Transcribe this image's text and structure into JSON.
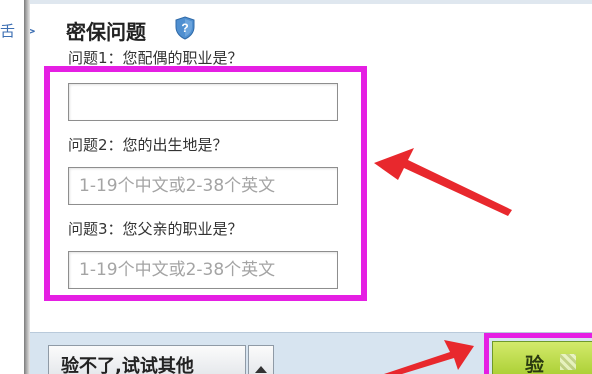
{
  "left_pane": {
    "text": "舌 >"
  },
  "security_questions": {
    "title": "密保问题",
    "title_icon": "shield-question-icon",
    "question1": {
      "label": "问题1：您配偶的职业是？",
      "value": "",
      "placeholder": ""
    },
    "question2": {
      "label": "问题2：您的出生地是？",
      "value": "",
      "placeholder": "1-19个中文或2-38个英文"
    },
    "question3": {
      "label": "问题3：您父亲的职业是？",
      "value": "",
      "placeholder": "1-19个中文或2-38个英文"
    }
  },
  "footer": {
    "alt_button_label": "验不了,试试其他",
    "dropdown_icon": "caret-up-icon",
    "verify_button_label": "验"
  },
  "annotations": {
    "highlight_color": "#e51fe3",
    "arrow_color": "#e8282d"
  },
  "colors": {
    "footer_bar": "#d7e4f0",
    "verify_button": "#b5d63b",
    "link_blue": "#3d6fb3"
  }
}
